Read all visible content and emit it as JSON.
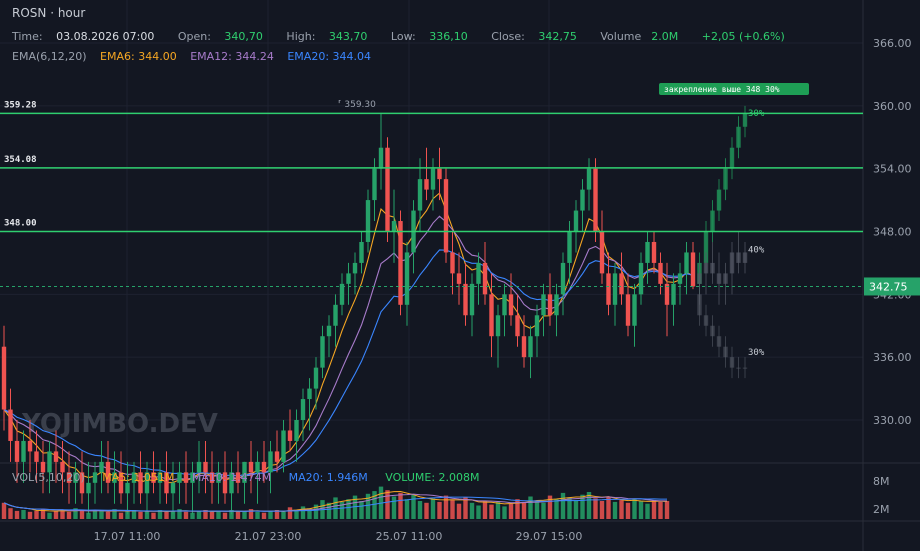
{
  "header": {
    "symbol": "ROSN · hour",
    "time_label": "Time:",
    "time": "03.08.2026 07:00",
    "open_label": "Open:",
    "open": "340,70",
    "high_label": "High:",
    "high": "343,70",
    "low_label": "Low:",
    "low": "336,10",
    "close_label": "Close:",
    "close": "342,75",
    "volume_label": "Volume",
    "volume": "2.0M",
    "change": "+2,05 (+0.6%)"
  },
  "ema_legend": {
    "title": "EMA(6,12,20)",
    "ema6": "EMA6: 344.00",
    "ema12": "EMA12: 344.24",
    "ema20": "EMA20: 344.04"
  },
  "vol_legend": {
    "title": "VOL(5,10,20)",
    "ma5": "MA5: 1.051M",
    "ma10": "MA10: 1.474M",
    "ma20": "MA20: 1.946M",
    "volume": "VOLUME: 2.008M"
  },
  "watermark": "YOJIMBO.DEV",
  "colors": {
    "up": "#26a269",
    "down": "#ef5350",
    "level": "#2fcf6f",
    "ema6": "#f5a623",
    "ema12": "#a77bca",
    "ema20": "#3a86ff",
    "background": "#131722",
    "price_tag": "#26a269"
  },
  "chart_data": {
    "type": "candlestick",
    "price_axis": {
      "ticks": [
        330,
        336,
        342,
        348,
        354,
        360,
        366
      ],
      "tick_labels": [
        "330.00",
        "336.00",
        "342.00",
        "348.00",
        "354.00",
        "360.00",
        "366.00"
      ]
    },
    "volume_axis": {
      "tick_labels": [
        "2M",
        "8M"
      ]
    },
    "time_labels": [
      "17.07 11:00",
      "21.07 23:00",
      "25.07 11:00",
      "29.07 15:00"
    ],
    "levels": [
      {
        "label": "359.28",
        "value": 359.28
      },
      {
        "label": "354.08",
        "value": 354.08
      },
      {
        "label": "348.00",
        "value": 348.0
      }
    ],
    "current_price": "342.75",
    "high_marker": "359.30",
    "scenario_label": "закрепление выше 348 30%",
    "scenario_percents": [
      "30%",
      "40%",
      "30%"
    ],
    "candles": [
      [
        337,
        339,
        329,
        331
      ],
      [
        331,
        333,
        326,
        328
      ],
      [
        328,
        330,
        324,
        326
      ],
      [
        326,
        329,
        324,
        328
      ],
      [
        328,
        330,
        325,
        327
      ],
      [
        327,
        329,
        324,
        326
      ],
      [
        326,
        328,
        323,
        325
      ],
      [
        325,
        328,
        323,
        327
      ],
      [
        327,
        329,
        324,
        326
      ],
      [
        326,
        328,
        323,
        325
      ],
      [
        325,
        327,
        322,
        324
      ],
      [
        324,
        326,
        322,
        325
      ],
      [
        325,
        327,
        322,
        323
      ],
      [
        323,
        326,
        321,
        324
      ],
      [
        324,
        326,
        322,
        325
      ],
      [
        325,
        328,
        323,
        326
      ],
      [
        326,
        328,
        323,
        324
      ],
      [
        324,
        327,
        322,
        325
      ],
      [
        325,
        327,
        322,
        323
      ],
      [
        323,
        326,
        321,
        324
      ],
      [
        324,
        326,
        322,
        325
      ],
      [
        325,
        327,
        322,
        323
      ],
      [
        323,
        326,
        321,
        325
      ],
      [
        325,
        327,
        323,
        324
      ],
      [
        324,
        326,
        322,
        325
      ],
      [
        325,
        327,
        322,
        323
      ],
      [
        323,
        326,
        321,
        324
      ],
      [
        324,
        326,
        322,
        325
      ],
      [
        325,
        327,
        322,
        324
      ],
      [
        324,
        326,
        321,
        325
      ],
      [
        325,
        328,
        323,
        326
      ],
      [
        326,
        328,
        323,
        325
      ],
      [
        325,
        327,
        322,
        324
      ],
      [
        324,
        326,
        322,
        325
      ],
      [
        325,
        327,
        322,
        323
      ],
      [
        323,
        326,
        321,
        325
      ],
      [
        325,
        327,
        323,
        324
      ],
      [
        324,
        326,
        322,
        326
      ],
      [
        326,
        328,
        323,
        325
      ],
      [
        325,
        327,
        322,
        326
      ],
      [
        326,
        328,
        324,
        325
      ],
      [
        325,
        328,
        323,
        327
      ],
      [
        327,
        329,
        325,
        326
      ],
      [
        326,
        330,
        325,
        329
      ],
      [
        329,
        331,
        327,
        328
      ],
      [
        328,
        331,
        326,
        330
      ],
      [
        330,
        333,
        328,
        332
      ],
      [
        332,
        334,
        329,
        333
      ],
      [
        333,
        336,
        331,
        335
      ],
      [
        335,
        339,
        334,
        338
      ],
      [
        338,
        340,
        336,
        339
      ],
      [
        339,
        342,
        337,
        341
      ],
      [
        341,
        344,
        340,
        343
      ],
      [
        343,
        345,
        341,
        344
      ],
      [
        344,
        346,
        342,
        345
      ],
      [
        345,
        348,
        344,
        347
      ],
      [
        347,
        352,
        346,
        351
      ],
      [
        351,
        355,
        349,
        354
      ],
      [
        354,
        359.3,
        352,
        356
      ],
      [
        356,
        357,
        347,
        348
      ],
      [
        348,
        352,
        345,
        349
      ],
      [
        349,
        350,
        340,
        341
      ],
      [
        341,
        347,
        339,
        346
      ],
      [
        346,
        351,
        344,
        350
      ],
      [
        350,
        355,
        348,
        353
      ],
      [
        353,
        356,
        351,
        352
      ],
      [
        352,
        355,
        350,
        354
      ],
      [
        354,
        356,
        351,
        353
      ],
      [
        353,
        354,
        345,
        346
      ],
      [
        346,
        348,
        342,
        344
      ],
      [
        344,
        346,
        341,
        343
      ],
      [
        343,
        345,
        339,
        340
      ],
      [
        340,
        344,
        338,
        343
      ],
      [
        343,
        346,
        341,
        345
      ],
      [
        345,
        347,
        341,
        342
      ],
      [
        342,
        344,
        336,
        338
      ],
      [
        338,
        341,
        335,
        340
      ],
      [
        340,
        343,
        338,
        342
      ],
      [
        342,
        344,
        339,
        340
      ],
      [
        340,
        342,
        337,
        338
      ],
      [
        338,
        340,
        335,
        336
      ],
      [
        336,
        339,
        334,
        338
      ],
      [
        338,
        341,
        336,
        340
      ],
      [
        340,
        343,
        338,
        342
      ],
      [
        342,
        344,
        339,
        340
      ],
      [
        340,
        343,
        338,
        342
      ],
      [
        342,
        346,
        340,
        345
      ],
      [
        345,
        349,
        343,
        348
      ],
      [
        348,
        351,
        346,
        350
      ],
      [
        350,
        353,
        348,
        352
      ],
      [
        352,
        355,
        350,
        354
      ],
      [
        354,
        355,
        347,
        348
      ],
      [
        348,
        350,
        343,
        344
      ],
      [
        344,
        346,
        340,
        341
      ],
      [
        341,
        345,
        339,
        344
      ],
      [
        344,
        346,
        341,
        342
      ],
      [
        342,
        344,
        338,
        339
      ],
      [
        339,
        343,
        337,
        342
      ],
      [
        342,
        346,
        341,
        345
      ],
      [
        345,
        348,
        343,
        347
      ],
      [
        347,
        348,
        344,
        345
      ],
      [
        345,
        346,
        342,
        343
      ],
      [
        343,
        345,
        338,
        341
      ],
      [
        341,
        344,
        339,
        343
      ],
      [
        343,
        345,
        341,
        344
      ],
      [
        344,
        347,
        342,
        346
      ],
      [
        346,
        347,
        342.5,
        342.75
      ]
    ],
    "volumes": [
      1.8,
      1.2,
      0.9,
      1.0,
      0.8,
      0.9,
      1.1,
      0.7,
      0.9,
      1.0,
      0.8,
      1.2,
      0.9,
      0.7,
      1.0,
      0.9,
      0.8,
      1.1,
      0.7,
      0.9,
      1.0,
      0.8,
      0.9,
      0.7,
      1.0,
      0.8,
      0.9,
      1.1,
      0.8,
      0.7,
      0.9,
      1.0,
      0.8,
      0.9,
      0.7,
      1.0,
      0.8,
      0.9,
      1.1,
      0.8,
      0.7,
      0.9,
      1.0,
      0.8,
      1.3,
      1.0,
      1.4,
      1.2,
      1.6,
      2.1,
      1.8,
      2.4,
      1.9,
      2.2,
      2.6,
      2.0,
      2.8,
      3.1,
      3.6,
      3.2,
      2.5,
      2.9,
      2.2,
      2.7,
      2.0,
      1.8,
      2.3,
      1.9,
      2.6,
      2.1,
      1.7,
      2.4,
      1.8,
      1.5,
      2.0,
      1.6,
      1.9,
      1.4,
      1.7,
      2.2,
      1.9,
      2.5,
      2.0,
      1.8,
      2.6,
      2.2,
      2.9,
      2.4,
      2.1,
      2.7,
      3.0,
      2.3,
      2.0,
      2.4,
      1.9,
      2.1,
      1.8,
      2.2,
      2.0,
      1.7,
      2.1,
      1.9,
      2.0
    ],
    "ema6_label": "EMA6",
    "ema12_label": "EMA12",
    "ema20_label": "EMA20"
  }
}
